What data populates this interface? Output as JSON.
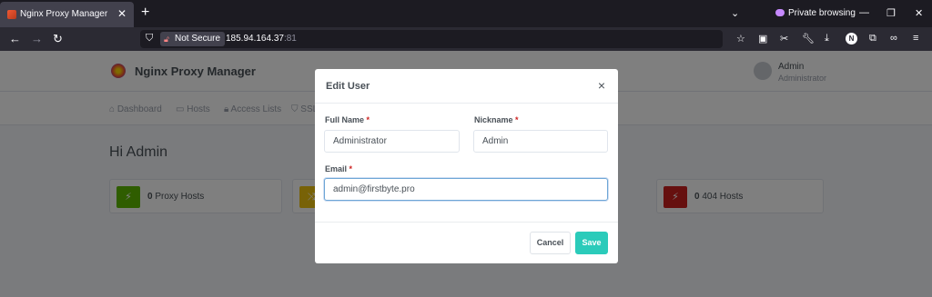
{
  "browser": {
    "tab_title": "Nginx Proxy Manager",
    "tab_close": "✕",
    "new_tab": "+",
    "private_label": "Private browsing",
    "security_label": "Not Secure",
    "url_host": "185.94.164.37",
    "url_port": ":81",
    "window_controls": [
      "—",
      "❐",
      "✕"
    ],
    "chevron": "⌄"
  },
  "app": {
    "brand": "Nginx Proxy Manager",
    "user_name": "Admin",
    "user_role": "Administrator",
    "menu": [
      "Dashboard",
      "Hosts",
      "Access Lists",
      "SSL"
    ],
    "greeting": "Hi Admin",
    "cards": [
      {
        "count": "0",
        "label": "Proxy Hosts",
        "color": "#5eba00"
      },
      {
        "count": "",
        "label": "",
        "color": "#f1c40f"
      },
      {
        "count": "0",
        "label": "404 Hosts",
        "color": "#cd201f"
      }
    ]
  },
  "modal": {
    "title": "Edit User",
    "close": "×",
    "full_name_label": "Full Name",
    "full_name_value": "Administrator",
    "nickname_label": "Nickname",
    "nickname_value": "Admin",
    "email_label": "Email",
    "email_value": "admin@firstbyte.pro",
    "required_mark": "*",
    "cancel_label": "Cancel",
    "save_label": "Save"
  },
  "colors": {
    "accent": "#2bcbba",
    "danger": "#cd201f",
    "success": "#5eba00",
    "warning": "#f1c40f"
  }
}
